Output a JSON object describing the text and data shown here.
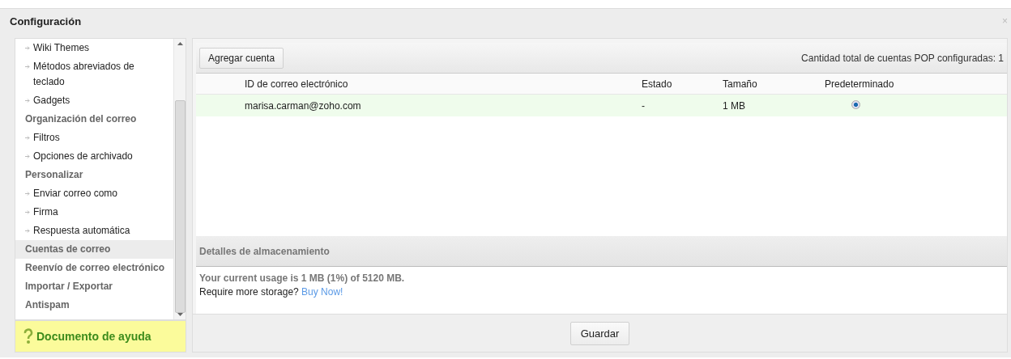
{
  "window": {
    "title": "Configuración",
    "close": "×"
  },
  "sidebar": {
    "items": [
      {
        "label": "Wiki Themes",
        "kind": "link",
        "selected": false
      },
      {
        "label": "Métodos abreviados de teclado",
        "kind": "link",
        "selected": false
      },
      {
        "label": "Gadgets",
        "kind": "link",
        "selected": false
      },
      {
        "label": "Organización del correo",
        "kind": "section",
        "selected": false
      },
      {
        "label": "Filtros",
        "kind": "link",
        "selected": false
      },
      {
        "label": "Opciones de archivado",
        "kind": "link",
        "selected": false
      },
      {
        "label": "Personalizar",
        "kind": "section",
        "selected": false
      },
      {
        "label": "Enviar correo como",
        "kind": "link",
        "selected": false
      },
      {
        "label": "Firma",
        "kind": "link",
        "selected": false
      },
      {
        "label": "Respuesta automática",
        "kind": "link",
        "selected": false
      },
      {
        "label": "Cuentas de correo",
        "kind": "section",
        "selected": true
      },
      {
        "label": "Reenvío de correo electrónico",
        "kind": "section",
        "selected": false
      },
      {
        "label": "Importar / Exportar",
        "kind": "section",
        "selected": false
      },
      {
        "label": "Antispam",
        "kind": "section",
        "selected": false
      }
    ],
    "help": "Documento de ayuda"
  },
  "toolbar": {
    "add_button": "Agregar cuenta",
    "count": "Cantidad total de cuentas POP configuradas: 1"
  },
  "table": {
    "columns": [
      "ID de correo electrónico",
      "Estado",
      "Tamaño",
      "Predeterminado"
    ],
    "rows": [
      {
        "email": "marisa.carman@zoho.com",
        "status": "-",
        "size": "1 MB",
        "default": true
      }
    ]
  },
  "storage": {
    "title": "Detalles de almacenamiento",
    "usage": "Your current usage is 1 MB (1%) of 5120 MB.",
    "prompt": "Require more storage?",
    "link": "Buy Now!"
  },
  "footer": {
    "save_button": "Guardar"
  }
}
